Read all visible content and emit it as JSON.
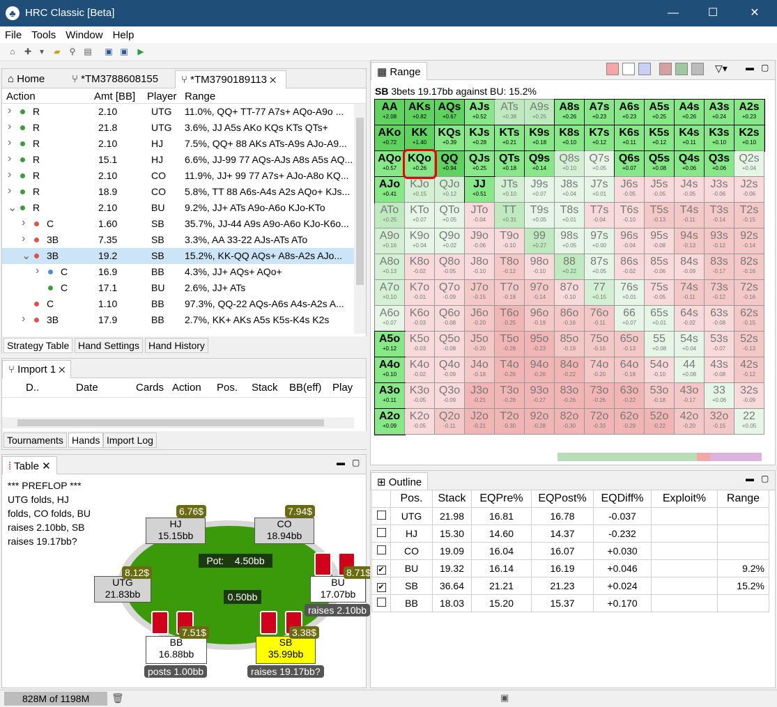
{
  "app": {
    "title": "HRC Classic [Beta]"
  },
  "menu": [
    "File",
    "Tools",
    "Window",
    "Help"
  ],
  "tabs": {
    "home": "Home",
    "tm1": "*TM3788608155",
    "tm2": "*TM3790189113"
  },
  "strategy": {
    "headers": [
      "Action",
      "Amt [BB]",
      "Player",
      "Range"
    ],
    "rows": [
      {
        "ind": 0,
        "tog": ">",
        "dot": "#3c9c3c",
        "act": "R",
        "amt": "2.10",
        "pl": "UTG",
        "rng": "11.0%, QQ+ TT-77 A7s+ AQo-A9o ..."
      },
      {
        "ind": 0,
        "tog": ">",
        "dot": "#3c9c3c",
        "act": "R",
        "amt": "21.8",
        "pl": "UTG",
        "rng": "3.6%, JJ A5s AKo KQs KTs QTs+"
      },
      {
        "ind": 0,
        "tog": ">",
        "dot": "#3c9c3c",
        "act": "R",
        "amt": "2.10",
        "pl": "HJ",
        "rng": "7.5%, QQ+ 88 AKs ATs-A9s AJo-A9..."
      },
      {
        "ind": 0,
        "tog": ">",
        "dot": "#3c9c3c",
        "act": "R",
        "amt": "15.1",
        "pl": "HJ",
        "rng": "6.6%, JJ-99 77 AQs-AJs A8s A5s AQ..."
      },
      {
        "ind": 0,
        "tog": ">",
        "dot": "#3c9c3c",
        "act": "R",
        "amt": "2.10",
        "pl": "CO",
        "rng": "11.9%, JJ+ 99 77 A7s+ AJo-A8o KQ..."
      },
      {
        "ind": 0,
        "tog": ">",
        "dot": "#3c9c3c",
        "act": "R",
        "amt": "18.9",
        "pl": "CO",
        "rng": "5.8%, TT 88 A6s-A4s A2s AQo+ KJs..."
      },
      {
        "ind": 0,
        "tog": "v",
        "dot": "#3c9c3c",
        "act": "R",
        "amt": "2.10",
        "pl": "BU",
        "rng": "9.2%, JJ+ ATs A9o-A6o KJo-KTo"
      },
      {
        "ind": 1,
        "tog": ">",
        "dot": "#d9534f",
        "act": "C",
        "amt": "1.60",
        "pl": "SB",
        "rng": "35.7%, JJ-44 A9s A9o-A6o KJo-K6o..."
      },
      {
        "ind": 1,
        "tog": ">",
        "dot": "#d9534f",
        "act": "3B",
        "amt": "7.35",
        "pl": "SB",
        "rng": "3.3%, AA 33-22 AJs-ATs ATo"
      },
      {
        "ind": 1,
        "tog": "v",
        "dot": "#d9534f",
        "act": "3B",
        "amt": "19.2",
        "pl": "SB",
        "rng": "15.2%, KK-QQ AQs+ A8s-A2s AJo..."
      },
      {
        "ind": 2,
        "tog": ">",
        "dot": "#4a90d9",
        "act": "C",
        "amt": "16.9",
        "pl": "BB",
        "rng": "4.3%, JJ+ AQs+ AQo+"
      },
      {
        "ind": 2,
        "tog": "",
        "dot": "#3c9c3c",
        "act": "C",
        "amt": "17.1",
        "pl": "BU",
        "rng": "2.6%, JJ+ ATs"
      },
      {
        "ind": 1,
        "tog": "",
        "dot": "#d9534f",
        "act": "C",
        "amt": "1.10",
        "pl": "BB",
        "rng": "97.3%, QQ-22 AQs-A6s A4s-A2s A..."
      },
      {
        "ind": 1,
        "tog": ">",
        "dot": "#d9534f",
        "act": "3B",
        "amt": "17.9",
        "pl": "BB",
        "rng": "2.7%, KK+ AKs A5s K5s-K4s K2s"
      }
    ],
    "bottom_tabs": [
      "Strategy Table",
      "Hand Settings",
      "Hand History"
    ]
  },
  "import": {
    "tab": "Import 1",
    "cols": [
      "D..",
      "Date",
      "Cards",
      "Action",
      "Pos.",
      "Stack",
      "BB(eff)",
      "Play"
    ],
    "bottom_tabs": [
      "Tournaments",
      "Hands",
      "Import Log"
    ]
  },
  "tablepanel": {
    "tab": "Table",
    "log": "*** PREFLOP ***\nUTG folds, HJ folds, CO folds, BU raises 2.10bb, SB raises 19.17bb?",
    "pot": "Pot:    4.50bb",
    "center": "0.50bb",
    "seats": {
      "hj": {
        "name": "HJ",
        "stack": "15.15bb",
        "chips": "6.76$"
      },
      "co": {
        "name": "CO",
        "stack": "18.94bb",
        "chips": "7.94$"
      },
      "utg": {
        "name": "UTG",
        "stack": "21.83bb",
        "chips": "8.12$"
      },
      "bu": {
        "name": "BU",
        "stack": "17.07bb",
        "chips": "8.71$",
        "action": "raises 2.10bb"
      },
      "bb": {
        "name": "BB",
        "stack": "16.88bb",
        "chips": "7.51$",
        "action": "posts 1.00bb"
      },
      "sb": {
        "name": "SB",
        "stack": "35.99bb",
        "chips": "3.38$",
        "action": "raises 19.17bb?"
      }
    }
  },
  "range": {
    "tab": "Range",
    "title_bold": "SB",
    "title_rest": " 3bets 19.17bb against BU: 15.2%"
  },
  "outline": {
    "tab": "Outline",
    "headers": [
      "",
      "Pos.",
      "Stack",
      "EQPre%",
      "EQPost%",
      "EQDiff%",
      "Exploit%",
      "Range"
    ],
    "rows": [
      {
        "chk": false,
        "pos": "UTG",
        "stack": "21.98",
        "pre": "16.81",
        "post": "16.78",
        "diff": "-0.037",
        "exp": "",
        "rng": ""
      },
      {
        "chk": false,
        "pos": "HJ",
        "stack": "15.30",
        "pre": "14.60",
        "post": "14.37",
        "diff": "-0.232",
        "exp": "",
        "rng": ""
      },
      {
        "chk": false,
        "pos": "CO",
        "stack": "19.09",
        "pre": "16.04",
        "post": "16.07",
        "diff": "+0.030",
        "exp": "",
        "rng": ""
      },
      {
        "chk": true,
        "pos": "BU",
        "stack": "19.32",
        "pre": "16.14",
        "post": "16.19",
        "diff": "+0.046",
        "exp": "",
        "rng": "9.2%"
      },
      {
        "chk": true,
        "pos": "SB",
        "stack": "36.64",
        "pre": "21.21",
        "post": "21.23",
        "diff": "+0.024",
        "exp": "",
        "rng": "15.2%"
      },
      {
        "chk": false,
        "pos": "BB",
        "stack": "18.03",
        "pre": "15.20",
        "post": "15.37",
        "diff": "+0.170",
        "exp": "",
        "rng": ""
      }
    ]
  },
  "status": {
    "memory": "828M of 1198M"
  },
  "grid": [
    [
      "AA|+2.08|1",
      "AKs|+0.82|1",
      "AQs|+0.67|1",
      "AJs|+0.52|1",
      "ATs|+0.38|0",
      "A9s|+0.25|0",
      "A8s|+0.26|1",
      "A7s|+0.23|1",
      "A6s|+0.23|1",
      "A5s|+0.25|1",
      "A4s|+0.26|1",
      "A3s|+0.24|1",
      "A2s|+0.23|1"
    ],
    [
      "AKo|+0.72|1",
      "KK|+1.40|1",
      "KQs|+0.39|1",
      "KJs|+0.28|1",
      "KTs|+0.21|1",
      "K9s|+0.18|1",
      "K8s|+0.10|1",
      "K7s|+0.12|1",
      "K6s|+0.11|1",
      "K5s|+0.12|1",
      "K4s|+0.11|1",
      "K3s|+0.10|1",
      "K2s|+0.10|1"
    ],
    [
      "AQo|+0.57|1",
      "KQo|+0.26|1",
      "QQ|+0.94|1",
      "QJs|+0.25|1",
      "QTs|+0.18|1",
      "Q9s|+0.14|1",
      "Q8s|+0.10|0",
      "Q7s|+0.05|0",
      "Q6s|+0.07|1",
      "Q5s|+0.08|1",
      "Q4s|+0.06|1",
      "Q3s|+0.06|1",
      "Q2s|+0.04|0"
    ],
    [
      "AJo|+0.41|1",
      "KJo|+0.15|0",
      "QJo|+0.12|0",
      "JJ|+0.51|1",
      "JTs|+0.10|0",
      "J9s|+0.07|0",
      "J8s|+0.04|0",
      "J7s|+0.01|0",
      "J6s|-0.05|0",
      "J5s|-0.05|0",
      "J4s|-0.05|0",
      "J3s|-0.06|0",
      "J2s|-0.06|0"
    ],
    [
      "ATo|+0.25|0",
      "KTo|+0.07|0",
      "QTo|+0.05|0",
      "JTo|-0.04|0",
      "TT|+0.31|0",
      "T9s|+0.05|0",
      "T8s|+0.01|0",
      "T7s|-0.04|0",
      "T6s|-0.10|0",
      "T5s|-0.13|0",
      "T4s|-0.11|0",
      "T3s|-0.14|0",
      "T2s|-0.15|0"
    ],
    [
      "A9o|+0.16|0",
      "K9o|+0.04|0",
      "Q9o|+0.02|0",
      "J9o|-0.06|0",
      "T9o|-0.10|0",
      "99|+0.27|0",
      "98s|+0.05|0",
      "97s|+0.00|0",
      "96s|-0.04|0",
      "95s|-0.08|0",
      "94s|-0.13|0",
      "93s|-0.12|0",
      "92s|-0.14|0"
    ],
    [
      "A8o|+0.13|0",
      "K8o|-0.02|0",
      "Q8o|-0.05|0",
      "J8o|-0.10|0",
      "T8o|-0.12|0",
      "98o|-0.10|0",
      "88|+0.22|0",
      "87s|+0.05|0",
      "86s|-0.02|0",
      "85s|-0.06|0",
      "84s|-0.09|0",
      "83s|-0.17|0",
      "82s|-0.16|0"
    ],
    [
      "A7o|+0.10|0",
      "K7o|-0.01|0",
      "Q7o|-0.09|0",
      "J7o|-0.15|0",
      "T7o|-0.18|0",
      "97o|-0.14|0",
      "87o|-0.10|0",
      "77|+0.15|0",
      "76s|+0.01|0",
      "75s|-0.05|0",
      "74s|-0.11|0",
      "73s|-0.12|0",
      "72s|-0.16|0"
    ],
    [
      "A6o|+0.07|0",
      "K6o|-0.03|0",
      "Q6o|-0.08|0",
      "J6o|-0.20|0",
      "T6o|-0.25|0",
      "96o|-0.19|0",
      "86o|-0.16|0",
      "76o|-0.11|0",
      "66|+0.07|0",
      "65s|+0.01|0",
      "64s|-0.02|0",
      "63s|-0.08|0",
      "62s|-0.15|0"
    ],
    [
      "A5o|+0.12|1",
      "K5o|-0.03|0",
      "Q5o|-0.08|0",
      "J5o|-0.20|0",
      "T5o|-0.26|0",
      "95o|-0.23|0",
      "85o|-0.19|0",
      "75o|-0.16|0",
      "65o|-0.13|0",
      "55|+0.08|0",
      "54s|+0.04|0",
      "53s|-0.07|0",
      "52s|-0.13|0"
    ],
    [
      "A4o|+0.10|1",
      "K4o|-0.02|0",
      "Q4o|-0.09|0",
      "J4o|-0.18|0",
      "T4o|-0.26|0",
      "94o|-0.26|0",
      "84o|-0.22|0",
      "74o|-0.20|0",
      "64o|-0.18|0",
      "54o|-0.10|0",
      "44|+0.08|0",
      "43s|-0.08|0",
      "42s|-0.12|0"
    ],
    [
      "A3o|+0.11|1",
      "K3o|-0.05|0",
      "Q3o|-0.09|0",
      "J3o|-0.21|0",
      "T3o|-0.28|0",
      "93o|-0.27|0",
      "83o|-0.26|0",
      "73o|-0.26|0",
      "63o|-0.22|0",
      "53o|-0.18|0",
      "43o|-0.17|0",
      "33|+0.06|0",
      "32s|-0.09|0"
    ],
    [
      "A2o|+0.09|1",
      "K2o|-0.05|0",
      "Q2o|-0.11|0",
      "J2o|-0.21|0",
      "T2o|-0.30|0",
      "92o|-0.28|0",
      "82o|-0.30|0",
      "72o|-0.33|0",
      "62o|-0.29|0",
      "52o|-0.22|0",
      "42o|-0.20|0",
      "32o|-0.15|0",
      "22|+0.05|0"
    ]
  ]
}
